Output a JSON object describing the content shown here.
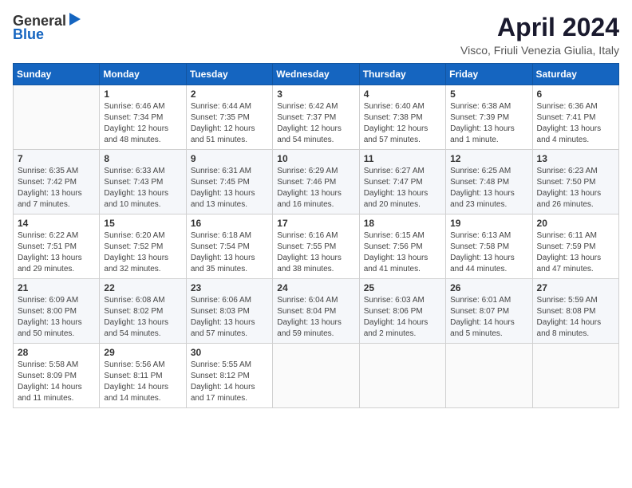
{
  "header": {
    "logo_general": "General",
    "logo_blue": "Blue",
    "title": "April 2024",
    "subtitle": "Visco, Friuli Venezia Giulia, Italy"
  },
  "calendar": {
    "columns": [
      "Sunday",
      "Monday",
      "Tuesday",
      "Wednesday",
      "Thursday",
      "Friday",
      "Saturday"
    ],
    "weeks": [
      [
        {
          "date": "",
          "sunrise": "",
          "sunset": "",
          "daylight": "",
          "empty": true
        },
        {
          "date": "1",
          "sunrise": "Sunrise: 6:46 AM",
          "sunset": "Sunset: 7:34 PM",
          "daylight": "Daylight: 12 hours and 48 minutes.",
          "empty": false
        },
        {
          "date": "2",
          "sunrise": "Sunrise: 6:44 AM",
          "sunset": "Sunset: 7:35 PM",
          "daylight": "Daylight: 12 hours and 51 minutes.",
          "empty": false
        },
        {
          "date": "3",
          "sunrise": "Sunrise: 6:42 AM",
          "sunset": "Sunset: 7:37 PM",
          "daylight": "Daylight: 12 hours and 54 minutes.",
          "empty": false
        },
        {
          "date": "4",
          "sunrise": "Sunrise: 6:40 AM",
          "sunset": "Sunset: 7:38 PM",
          "daylight": "Daylight: 12 hours and 57 minutes.",
          "empty": false
        },
        {
          "date": "5",
          "sunrise": "Sunrise: 6:38 AM",
          "sunset": "Sunset: 7:39 PM",
          "daylight": "Daylight: 13 hours and 1 minute.",
          "empty": false
        },
        {
          "date": "6",
          "sunrise": "Sunrise: 6:36 AM",
          "sunset": "Sunset: 7:41 PM",
          "daylight": "Daylight: 13 hours and 4 minutes.",
          "empty": false
        }
      ],
      [
        {
          "date": "7",
          "sunrise": "Sunrise: 6:35 AM",
          "sunset": "Sunset: 7:42 PM",
          "daylight": "Daylight: 13 hours and 7 minutes.",
          "empty": false
        },
        {
          "date": "8",
          "sunrise": "Sunrise: 6:33 AM",
          "sunset": "Sunset: 7:43 PM",
          "daylight": "Daylight: 13 hours and 10 minutes.",
          "empty": false
        },
        {
          "date": "9",
          "sunrise": "Sunrise: 6:31 AM",
          "sunset": "Sunset: 7:45 PM",
          "daylight": "Daylight: 13 hours and 13 minutes.",
          "empty": false
        },
        {
          "date": "10",
          "sunrise": "Sunrise: 6:29 AM",
          "sunset": "Sunset: 7:46 PM",
          "daylight": "Daylight: 13 hours and 16 minutes.",
          "empty": false
        },
        {
          "date": "11",
          "sunrise": "Sunrise: 6:27 AM",
          "sunset": "Sunset: 7:47 PM",
          "daylight": "Daylight: 13 hours and 20 minutes.",
          "empty": false
        },
        {
          "date": "12",
          "sunrise": "Sunrise: 6:25 AM",
          "sunset": "Sunset: 7:48 PM",
          "daylight": "Daylight: 13 hours and 23 minutes.",
          "empty": false
        },
        {
          "date": "13",
          "sunrise": "Sunrise: 6:23 AM",
          "sunset": "Sunset: 7:50 PM",
          "daylight": "Daylight: 13 hours and 26 minutes.",
          "empty": false
        }
      ],
      [
        {
          "date": "14",
          "sunrise": "Sunrise: 6:22 AM",
          "sunset": "Sunset: 7:51 PM",
          "daylight": "Daylight: 13 hours and 29 minutes.",
          "empty": false
        },
        {
          "date": "15",
          "sunrise": "Sunrise: 6:20 AM",
          "sunset": "Sunset: 7:52 PM",
          "daylight": "Daylight: 13 hours and 32 minutes.",
          "empty": false
        },
        {
          "date": "16",
          "sunrise": "Sunrise: 6:18 AM",
          "sunset": "Sunset: 7:54 PM",
          "daylight": "Daylight: 13 hours and 35 minutes.",
          "empty": false
        },
        {
          "date": "17",
          "sunrise": "Sunrise: 6:16 AM",
          "sunset": "Sunset: 7:55 PM",
          "daylight": "Daylight: 13 hours and 38 minutes.",
          "empty": false
        },
        {
          "date": "18",
          "sunrise": "Sunrise: 6:15 AM",
          "sunset": "Sunset: 7:56 PM",
          "daylight": "Daylight: 13 hours and 41 minutes.",
          "empty": false
        },
        {
          "date": "19",
          "sunrise": "Sunrise: 6:13 AM",
          "sunset": "Sunset: 7:58 PM",
          "daylight": "Daylight: 13 hours and 44 minutes.",
          "empty": false
        },
        {
          "date": "20",
          "sunrise": "Sunrise: 6:11 AM",
          "sunset": "Sunset: 7:59 PM",
          "daylight": "Daylight: 13 hours and 47 minutes.",
          "empty": false
        }
      ],
      [
        {
          "date": "21",
          "sunrise": "Sunrise: 6:09 AM",
          "sunset": "Sunset: 8:00 PM",
          "daylight": "Daylight: 13 hours and 50 minutes.",
          "empty": false
        },
        {
          "date": "22",
          "sunrise": "Sunrise: 6:08 AM",
          "sunset": "Sunset: 8:02 PM",
          "daylight": "Daylight: 13 hours and 54 minutes.",
          "empty": false
        },
        {
          "date": "23",
          "sunrise": "Sunrise: 6:06 AM",
          "sunset": "Sunset: 8:03 PM",
          "daylight": "Daylight: 13 hours and 57 minutes.",
          "empty": false
        },
        {
          "date": "24",
          "sunrise": "Sunrise: 6:04 AM",
          "sunset": "Sunset: 8:04 PM",
          "daylight": "Daylight: 13 hours and 59 minutes.",
          "empty": false
        },
        {
          "date": "25",
          "sunrise": "Sunrise: 6:03 AM",
          "sunset": "Sunset: 8:06 PM",
          "daylight": "Daylight: 14 hours and 2 minutes.",
          "empty": false
        },
        {
          "date": "26",
          "sunrise": "Sunrise: 6:01 AM",
          "sunset": "Sunset: 8:07 PM",
          "daylight": "Daylight: 14 hours and 5 minutes.",
          "empty": false
        },
        {
          "date": "27",
          "sunrise": "Sunrise: 5:59 AM",
          "sunset": "Sunset: 8:08 PM",
          "daylight": "Daylight: 14 hours and 8 minutes.",
          "empty": false
        }
      ],
      [
        {
          "date": "28",
          "sunrise": "Sunrise: 5:58 AM",
          "sunset": "Sunset: 8:09 PM",
          "daylight": "Daylight: 14 hours and 11 minutes.",
          "empty": false
        },
        {
          "date": "29",
          "sunrise": "Sunrise: 5:56 AM",
          "sunset": "Sunset: 8:11 PM",
          "daylight": "Daylight: 14 hours and 14 minutes.",
          "empty": false
        },
        {
          "date": "30",
          "sunrise": "Sunrise: 5:55 AM",
          "sunset": "Sunset: 8:12 PM",
          "daylight": "Daylight: 14 hours and 17 minutes.",
          "empty": false
        },
        {
          "date": "",
          "sunrise": "",
          "sunset": "",
          "daylight": "",
          "empty": true
        },
        {
          "date": "",
          "sunrise": "",
          "sunset": "",
          "daylight": "",
          "empty": true
        },
        {
          "date": "",
          "sunrise": "",
          "sunset": "",
          "daylight": "",
          "empty": true
        },
        {
          "date": "",
          "sunrise": "",
          "sunset": "",
          "daylight": "",
          "empty": true
        }
      ]
    ]
  }
}
